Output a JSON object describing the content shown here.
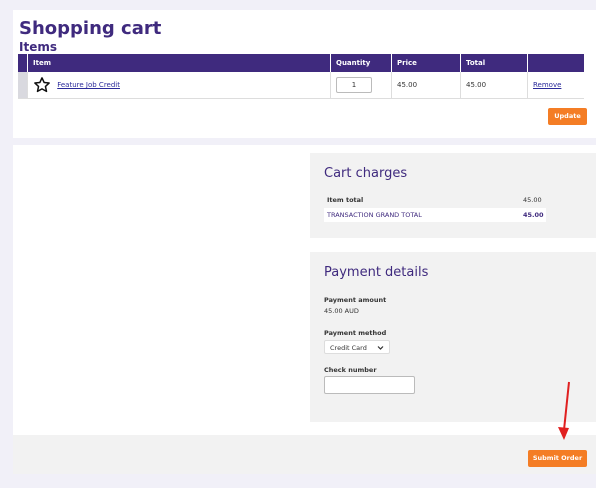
{
  "page": {
    "title": "Shopping cart",
    "subtitle": "Items"
  },
  "table": {
    "headers": [
      "Item",
      "Quantity",
      "Price",
      "Total"
    ],
    "row": {
      "item": "Feature Job Credit",
      "quantity": "1",
      "price": "45.00",
      "total": "45.00",
      "remove": "Remove"
    },
    "item_icon": "star-icon"
  },
  "buttons": {
    "update": "Update",
    "submit": "Submit Order"
  },
  "cart_charges": {
    "title": "Cart charges",
    "item_total_label": "Item total",
    "item_total_value": "45.00",
    "grand_total_label": "TRANSACTION GRAND TOTAL",
    "grand_total_value": "45.00"
  },
  "payment": {
    "title": "Payment details",
    "amount_label": "Payment amount",
    "amount_value": "45.00 AUD",
    "method_label": "Payment method",
    "method_value": "Credit Card",
    "check_label": "Check number",
    "check_value": ""
  },
  "colors": {
    "brand": "#3f2a7e",
    "accent": "#f47d25",
    "annotation": "#e02020"
  }
}
